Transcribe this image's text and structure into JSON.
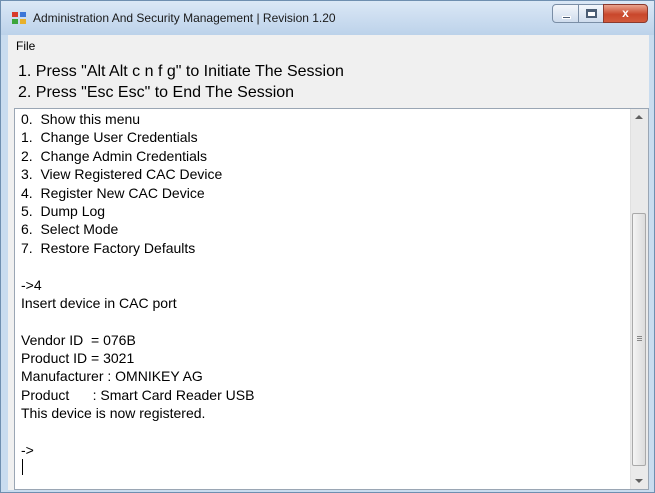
{
  "window": {
    "title": "Administration And Security Management  |  Revision 1.20",
    "controls": {
      "close_glyph": "x"
    }
  },
  "menu": {
    "file_label": "File"
  },
  "instructions": [
    "1. Press \"Alt Alt c n f g\" to Initiate The Session",
    "2. Press \"Esc Esc\" to End The Session"
  ],
  "console": {
    "lines": [
      "0.  Show this menu",
      "1.  Change User Credentials",
      "2.  Change Admin Credentials",
      "3.  View Registered CAC Device",
      "4.  Register New CAC Device",
      "5.  Dump Log",
      "6.  Select Mode",
      "7.  Restore Factory Defaults",
      "",
      "->4",
      "Insert device in CAC port",
      "",
      "Vendor ID  = 076B",
      "Product ID = 3021",
      "Manufacturer : OMNIKEY AG",
      "Product      : Smart Card Reader USB",
      "This device is now registered.",
      "",
      "->"
    ]
  },
  "colors": {
    "titlebar": "#c9dcef",
    "close_button": "#c9472c"
  }
}
